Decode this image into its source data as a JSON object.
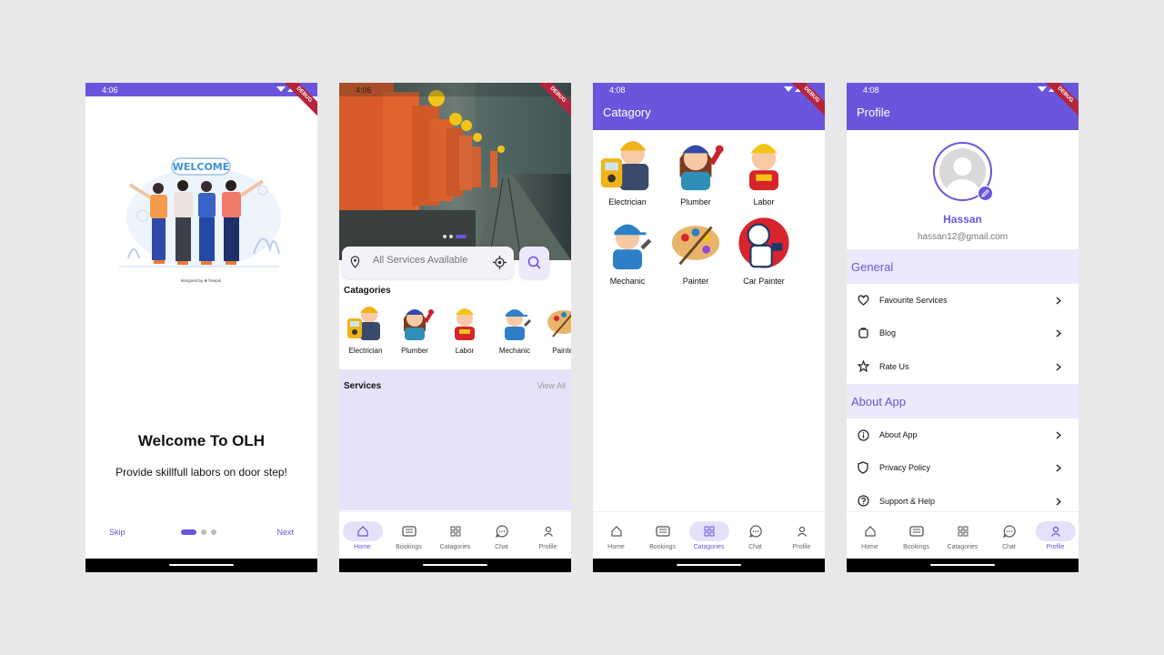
{
  "status": {
    "time1": "4:06",
    "time_hidden": "4:06",
    "time3": "4:08",
    "time4": "4:08"
  },
  "debug_label": "DEBUG",
  "onboarding": {
    "welcome_banner": "WELCOME",
    "credit": "designed by ❁ freepik",
    "title": "Welcome To OLH",
    "subtitle": "Provide skillfull labors on door step!",
    "skip": "Skip",
    "next": "Next"
  },
  "home": {
    "search_placeholder": "All Services Available",
    "categories_heading": "Catagories",
    "categories": [
      "Electrician",
      "Plumber",
      "Labor",
      "Mechanic",
      "Painter"
    ],
    "services_heading": "Services",
    "view_all": "View All"
  },
  "category_screen": {
    "title": "Catagory",
    "items": [
      "Electrician",
      "Plumber",
      "Labor",
      "Mechanic",
      "Painter",
      "Car Painter"
    ]
  },
  "profile": {
    "title": "Profile",
    "name": "Hassan",
    "email": "hassan12@gmail.com",
    "general_heading": "General",
    "general_items": [
      "Favourite Services",
      "Blog",
      "Rate Us"
    ],
    "about_heading": "About App",
    "about_items": [
      "About App",
      "Privacy Policy",
      "Support & Help"
    ]
  },
  "bottom_nav": [
    "Home",
    "Bookings",
    "Catagories",
    "Chat",
    "Profile"
  ],
  "colors": {
    "primary": "#6a56dc",
    "section_bg": "#ece9fb",
    "services_bg": "#e6e3f8",
    "debug_ribbon": "#b4243c"
  }
}
